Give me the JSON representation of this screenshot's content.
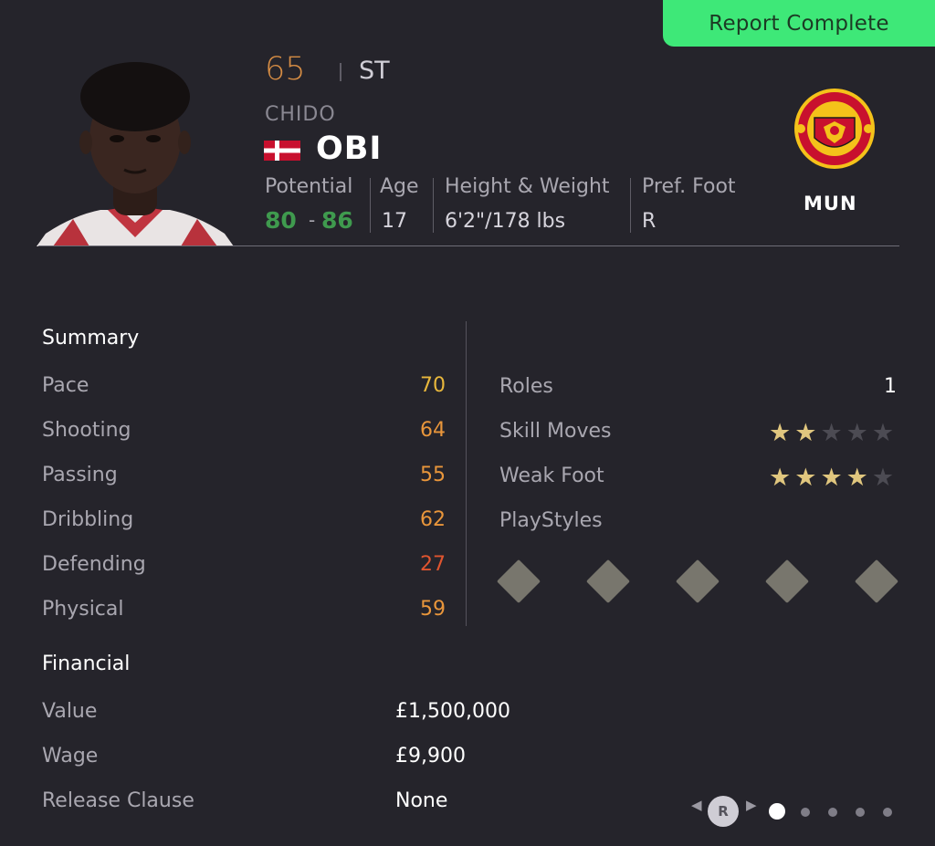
{
  "banner": {
    "label": "Report Complete"
  },
  "player": {
    "rating": "65",
    "position": "ST",
    "first_name": "CHIDO",
    "last_name": "OBI",
    "nationality_flag": "denmark-flag"
  },
  "info": {
    "potential_label": "Potential",
    "potential_low": "80",
    "potential_dash": "-",
    "potential_high": "86",
    "age_label": "Age",
    "age_value": "17",
    "hw_label": "Height & Weight",
    "hw_value": "6'2\"/178 lbs",
    "foot_label": "Pref. Foot",
    "foot_value": "R"
  },
  "club": {
    "abbr": "MUN",
    "crest_icon": "manchester-united-crest"
  },
  "summary": {
    "title": "Summary",
    "stats": [
      {
        "label": "Pace",
        "value": "70",
        "color": "#e8b73c"
      },
      {
        "label": "Shooting",
        "value": "64",
        "color": "#e9963b"
      },
      {
        "label": "Passing",
        "value": "55",
        "color": "#e9963b"
      },
      {
        "label": "Dribbling",
        "value": "62",
        "color": "#e9963b"
      },
      {
        "label": "Defending",
        "value": "27",
        "color": "#e0552f"
      },
      {
        "label": "Physical",
        "value": "59",
        "color": "#e9963b"
      }
    ]
  },
  "attributes": {
    "roles_label": "Roles",
    "roles_value": "1",
    "skill_moves_label": "Skill Moves",
    "skill_moves_rating": 2,
    "weak_foot_label": "Weak Foot",
    "weak_foot_rating": 4,
    "star_max": 5,
    "playstyles_label": "PlayStyles"
  },
  "financial": {
    "title": "Financial",
    "rows": [
      {
        "label": "Value",
        "value": "£1,500,000"
      },
      {
        "label": "Wage",
        "value": "£9,900"
      },
      {
        "label": "Release Clause",
        "value": "None"
      }
    ]
  },
  "pager": {
    "button_label": "R",
    "pages": 5,
    "active_page": 1
  },
  "colors": {
    "background": "#25242b",
    "banner": "#3ee878",
    "potential": "#3f9a4e",
    "rating": "#d58c44"
  }
}
